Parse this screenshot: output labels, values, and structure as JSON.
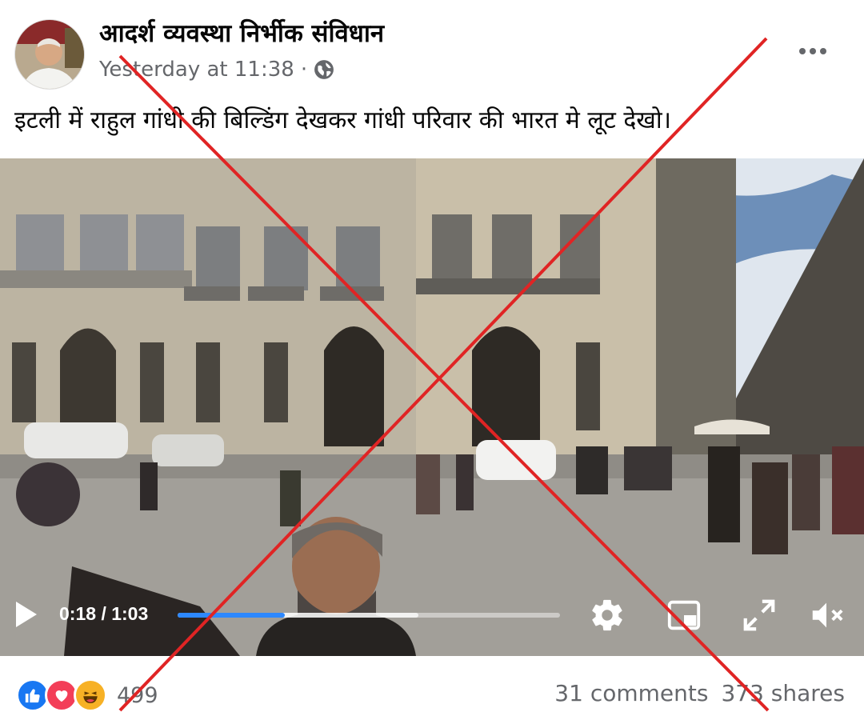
{
  "post": {
    "author_name": "आदर्श व्यवस्था निर्भीक संविधान",
    "timestamp": "Yesterday at 11:38",
    "separator": "·",
    "privacy_icon": "globe-icon",
    "more_icon": "more-horizontal-icon",
    "caption": "इटली में राहुल गांधी की बिल्डिंग देखकर गांधी परिवार की भारत मे लूट देखो।"
  },
  "video": {
    "current_time": "0:18",
    "time_separator": "/",
    "duration": "1:03",
    "progress_played": 0.28,
    "progress_buffered": 0.63,
    "controls": [
      "play-icon",
      "settings-gear-icon",
      "picture-in-picture-icon",
      "fullscreen-icon",
      "volume-muted-icon"
    ],
    "accent_color": "#2d88ff"
  },
  "footer": {
    "reactions": [
      "like-icon",
      "love-icon",
      "haha-icon"
    ],
    "reaction_count": "499",
    "comments": "31 comments",
    "shares": "373 shares"
  },
  "overlay": {
    "mark": "red-x-cross",
    "color": "#e02424"
  }
}
